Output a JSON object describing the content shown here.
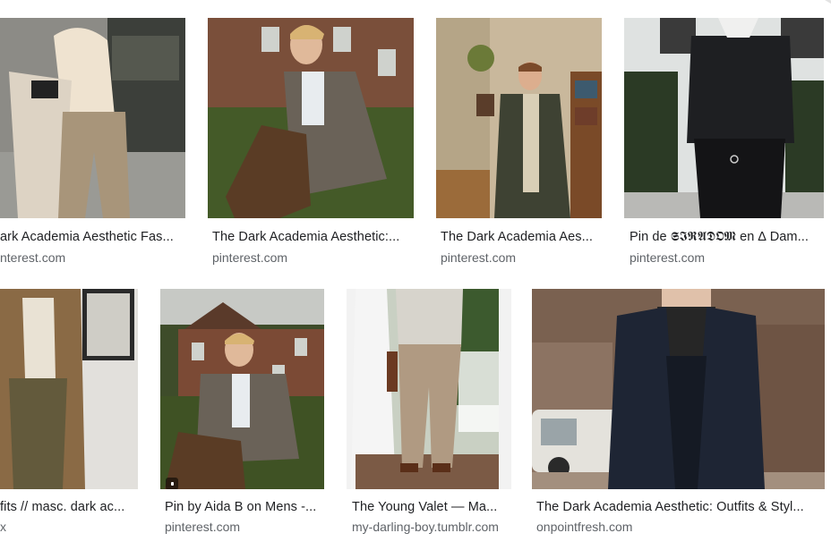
{
  "results": [
    {
      "title": "ark Academia Aesthetic Fas...",
      "source": "nterest.com",
      "image_icon": "woman-beige-coat-plaid-trousers-photo"
    },
    {
      "title": "The Dark Academia Aesthetic:...",
      "source": "pinterest.com",
      "image_icon": "man-smoking-on-lawn-photo"
    },
    {
      "title": "The Dark Academia Aes...",
      "source": "pinterest.com",
      "image_icon": "man-long-coat-interior-photo"
    },
    {
      "title": "Pin de 𝕾𝕴𝕽𝕬𝕯𝕺𝕸 en ∆ Dam...",
      "source": "pinterest.com",
      "image_icon": "man-black-sweater-photo"
    },
    {
      "title": "fits // masc. dark ac...",
      "source": "x",
      "image_icon": "man-brown-coat-poster-wall-photo"
    },
    {
      "title": "Pin by Aida B on Mens -...",
      "source": "pinterest.com",
      "image_icon": "man-smoking-brick-house-photo"
    },
    {
      "title": "The Young Valet — Ma...",
      "source": "my-darling-boy.tumblr.com",
      "image_icon": "man-beige-trousers-porch-photo"
    },
    {
      "title": "The Dark Academia Aesthetic: Outfits & Styl...",
      "source": "onpointfresh.com",
      "image_icon": "man-navy-coat-turtleneck-photo"
    }
  ],
  "colors": {
    "title": "#202124",
    "source": "#5f6368",
    "background": "#ffffff"
  }
}
